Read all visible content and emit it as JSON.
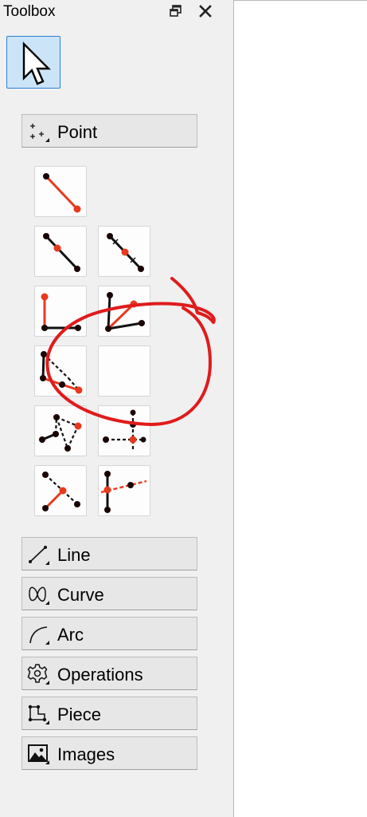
{
  "panel": {
    "title": "Toolbox",
    "float_icon": "float-window-icon",
    "close_icon": "close-icon"
  },
  "pointer_tool": {
    "icon": "arrow-pointer-icon",
    "selected": true
  },
  "groups": {
    "point": {
      "label": "Point",
      "icon": "point-group-icon"
    },
    "line": {
      "label": "Line",
      "icon": "line-group-icon"
    },
    "curve": {
      "label": "Curve",
      "icon": "curve-group-icon"
    },
    "arc": {
      "label": "Arc",
      "icon": "arc-group-icon"
    },
    "operations": {
      "label": "Operations",
      "icon": "gear-icon"
    },
    "piece": {
      "label": "Piece",
      "icon": "piece-group-icon"
    },
    "images": {
      "label": "Images",
      "icon": "image-icon"
    }
  },
  "point_tools": [
    "point-at-distance-icon",
    "point-along-line-icon",
    "point-on-line-icon",
    "normal-point-icon",
    "bisector-point-icon",
    "shoulder-point-icon",
    "empty-tool-slot",
    "point-of-contact-icon",
    "triangle-point-icon",
    "height-point-icon",
    "line-intersect-axis-icon"
  ],
  "colors": {
    "panel_bg": "#f0f0f0",
    "selected_bg": "#cce4f7",
    "selected_border": "#2d7fd1",
    "icon_red": "#e8391d",
    "annotation_red": "#e01b1b"
  }
}
